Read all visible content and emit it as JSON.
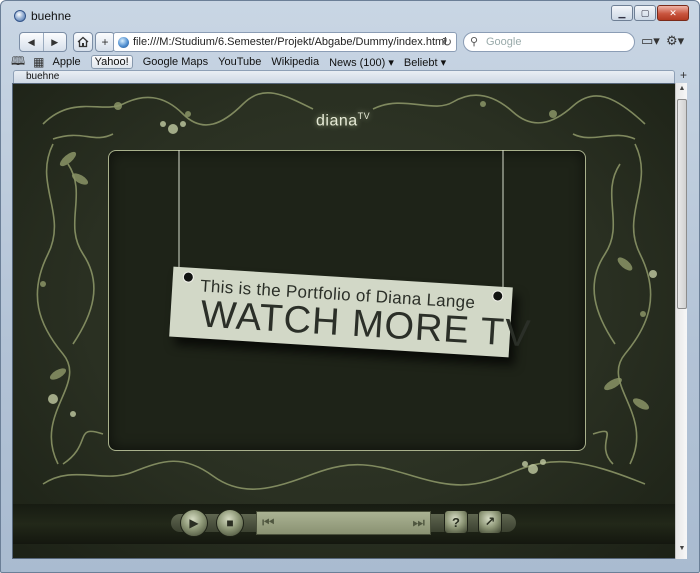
{
  "window": {
    "title": "buehne"
  },
  "toolbar": {
    "back_icon": "back-arrow-icon",
    "forward_icon": "forward-arrow-icon",
    "home_icon": "home-icon",
    "add_icon": "plus-icon",
    "address": "file:///M:/Studium/6.Semester/Projekt/Abgabe/Dummy/index.html",
    "search_placeholder": "Google"
  },
  "bookmarks": {
    "items": [
      "Apple",
      "Yahoo!",
      "Google Maps",
      "YouTube",
      "Wikipedia",
      "News (100)",
      "Beliebt"
    ]
  },
  "tabs": [
    {
      "label": "buehne"
    }
  ],
  "page": {
    "logo_text": "diana",
    "logo_sup": "TV",
    "sign_line1": "This is the Portfolio of Diana Lange",
    "sign_line2": "WATCH MORE TV"
  },
  "colors": {
    "background": "#2a3022",
    "ornament": "#8a9466",
    "sign": "#d2d8c7",
    "screen_border": "#a9b18c"
  }
}
